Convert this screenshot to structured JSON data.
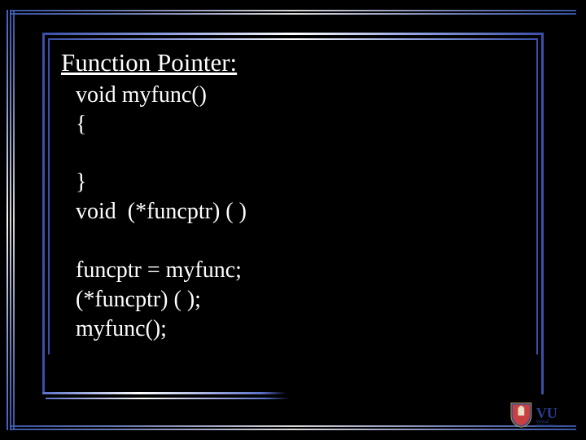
{
  "slide": {
    "title": "Function Pointer:",
    "code": "void myfunc()\n{\n\n}\nvoid  (*funcptr) ( )\n\nfuncptr = myfunc;\n(*funcptr) ( );\nmyfunc();"
  },
  "logo": {
    "initials": "VU",
    "subtitle": "Virtual University"
  }
}
